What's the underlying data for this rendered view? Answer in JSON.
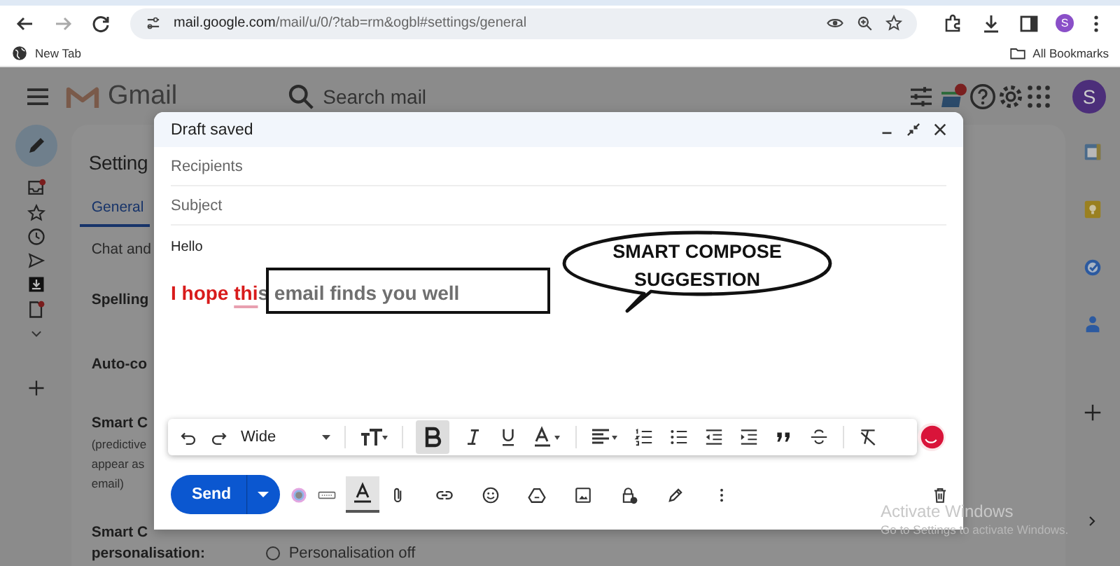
{
  "browser": {
    "url_host": "mail.google.com",
    "url_path": "/mail/u/0/?tab=rm&ogbl#settings/general",
    "bookmark": "New Tab",
    "all_bookmarks": "All Bookmarks",
    "profile_initial": "S"
  },
  "gmail": {
    "logo_text": "Gmail",
    "search_placeholder": "Search mail",
    "avatar_initial": "S"
  },
  "settings": {
    "title": "Setting",
    "tabs": [
      {
        "label": "General",
        "selected": true
      },
      {
        "label": "Chat and",
        "selected": false
      }
    ],
    "rows": [
      {
        "label_lines": [
          "Spelling"
        ]
      },
      {
        "label_lines": [
          "Auto-co"
        ]
      },
      {
        "label_lines": [
          "Smart C"
        ],
        "description_lines": [
          "(predictive",
          "appear as",
          "email)"
        ]
      },
      {
        "label_lines": [
          "Smart C",
          "personalisation:"
        ],
        "option": {
          "label": "Personalisation off",
          "selected": false
        }
      }
    ]
  },
  "compose": {
    "title": "Draft saved",
    "recipients_placeholder": "Recipients",
    "subject_placeholder": "Subject",
    "greeting": "Hello",
    "sentence": [
      {
        "text": "I hope ",
        "kind": "typed"
      },
      {
        "text": "thi",
        "kind": "flagged"
      },
      {
        "text": "s email finds you well",
        "kind": "suggestion"
      }
    ],
    "font": "Wide",
    "bold_active": true,
    "text_format_open": true,
    "send_label": "Send"
  },
  "annotation": {
    "callout": "SMART COMPOSE SUGGESTION"
  },
  "os_notice": {
    "title": "Activate Windows",
    "subtitle": "Go to Settings to activate Windows."
  }
}
